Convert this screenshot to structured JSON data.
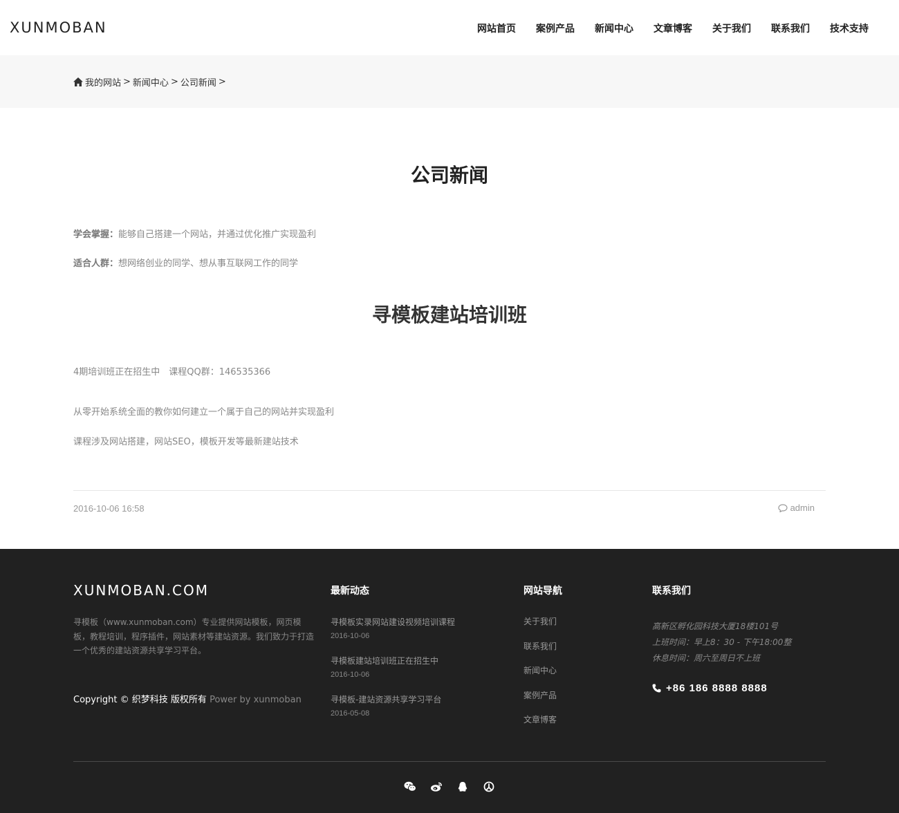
{
  "header": {
    "logo": "XUNMOBAN",
    "nav": [
      "网站首页",
      "案例产品",
      "新闻中心",
      "文章博客",
      "关于我们",
      "联系我们",
      "技术支持"
    ]
  },
  "breadcrumb": {
    "items": [
      "我的网站",
      "新闻中心",
      "公司新闻"
    ],
    "separator": ">"
  },
  "article": {
    "title": "公司新闻",
    "learn_label": "学会掌握：",
    "learn_text": "能够自己搭建一个网站，并通过优化推广实现盈利",
    "audience_label": "适合人群：",
    "audience_text": "想网络创业的同学、想从事互联网工作的同学",
    "subtitle": "寻模板建站培训班",
    "p1": "4期培训班正在招生中　课程QQ群：146535366",
    "p2": "从零开始系统全面的教你如何建立一个属于自己的网站并实现盈利",
    "p3": "课程涉及网站搭建，网站SEO，模板开发等最新建站技术",
    "date": "2016-10-06 16:58",
    "author": "admin"
  },
  "footer": {
    "brand": "XUNMOBAN.COM",
    "desc": "寻模板（www.xunmoban.com）专业提供网站模板，网页模板，教程培训，程序插件，网站素材等建站资源。我们致力于打造一个优秀的建站资源共享学习平台。",
    "copyright": "Copyright © 织梦科技 版权所有",
    "power": "Power by xunmoban",
    "news_title": "最新动态",
    "news": [
      {
        "title": "寻模板实录网站建设视频培训课程",
        "date": "2016-10-06"
      },
      {
        "title": "寻模板建站培训班正在招生中",
        "date": "2016-10-06"
      },
      {
        "title": "寻模板-建站资源共享学习平台",
        "date": "2016-05-08"
      }
    ],
    "nav_title": "网站导航",
    "nav": [
      "关于我们",
      "联系我们",
      "新闻中心",
      "案例产品",
      "文章博客"
    ],
    "contact_title": "联系我们",
    "address": "高新区孵化园科技大厦18楼101号",
    "hours": "上班时间：早上8：30 - 下午18:00整",
    "rest": "休息时间：周六至周日不上班",
    "phone": "+86 186 8888 8888",
    "socials": [
      "wechat-icon",
      "weibo-icon",
      "qq-icon",
      "tencent-weibo-icon"
    ]
  },
  "colors": {
    "footer_bg": "#212121",
    "crumb_bg": "#f7f7f7"
  }
}
